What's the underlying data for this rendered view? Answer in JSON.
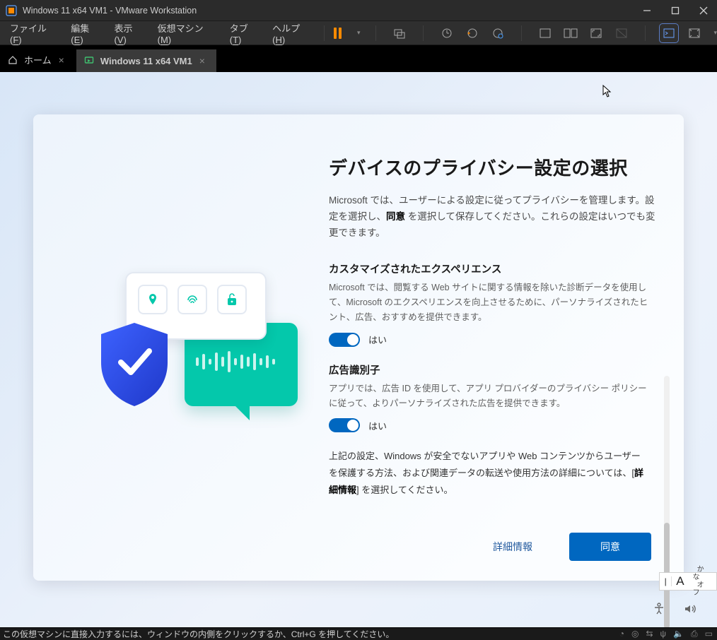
{
  "window": {
    "title": "Windows 11 x64 VM1 - VMware Workstation"
  },
  "menu": {
    "file": {
      "label": "ファイル",
      "accel": "F"
    },
    "edit": {
      "label": "編集",
      "accel": "E"
    },
    "view": {
      "label": "表示",
      "accel": "V"
    },
    "vm": {
      "label": "仮想マシン",
      "accel": "M"
    },
    "tabs": {
      "label": "タブ",
      "accel": "T"
    },
    "help": {
      "label": "ヘルプ",
      "accel": "H"
    }
  },
  "tabs": {
    "home": {
      "label": "ホーム"
    },
    "active": {
      "label": "Windows 11 x64 VM1"
    }
  },
  "oobe": {
    "heading": "デバイスのプライバシー設定の選択",
    "intro_pre": "Microsoft では、ユーザーによる設定に従ってプライバシーを管理します。設定を選択し、",
    "intro_strong": "同意",
    "intro_post": " を選択して保存してください。これらの設定はいつでも変更できます。",
    "sections": {
      "tailored": {
        "title": "カスタマイズされたエクスペリエンス",
        "desc": "Microsoft では、閲覧する Web サイトに関する情報を除いた診断データを使用して、Microsoft のエクスペリエンスを向上させるために、パーソナライズされたヒント、広告、おすすめを提供できます。",
        "toggle_label": "はい",
        "toggle_on": true
      },
      "adid": {
        "title": "広告識別子",
        "desc": "アプリでは、広告 ID を使用して、アプリ プロバイダーのプライバシー ポリシーに従って、よりパーソナライズされた広告を提供できます。",
        "toggle_label": "はい",
        "toggle_on": true
      }
    },
    "more_pre": "上記の設定、Windows が安全でないアプリや Web コンテンツからユーザーを保護する方法、および関連データの転送や使用方法の詳細については、[",
    "more_link": "詳細情報",
    "more_post": "] を選択してください。",
    "buttons": {
      "more": "詳細情報",
      "accept": "同意"
    }
  },
  "ime": {
    "mode": "A",
    "hint1": "かな",
    "hint2": "オフ"
  },
  "statusbar": {
    "hint": "この仮想マシンに直接入力するには、ウィンドウの内側をクリックするか、Ctrl+G を押してください。"
  }
}
